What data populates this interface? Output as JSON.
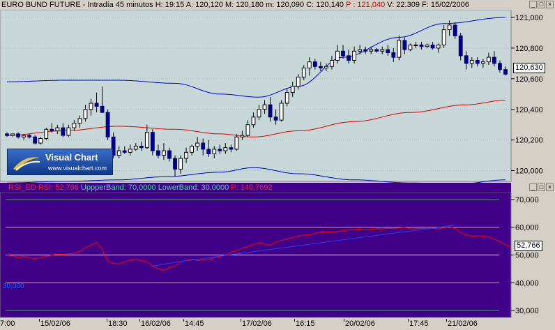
{
  "main_pane": {
    "title": {
      "instrument": "EURO BUND FUTURE - Intradía 45 minutos",
      "h": "H: 19:15",
      "a": "A: 120,120",
      "m": "M: 120,180",
      "m2": "m: 120,090",
      "c": "C: 120,140",
      "p": "P : 121,040",
      "v": "V: 22.309",
      "f": "F: 15/02/2006"
    },
    "price_tag": "120,630",
    "y_ticks": [
      "121,000",
      "120,800",
      "120,600",
      "120,400",
      "120,200",
      "120,000"
    ],
    "logo": {
      "line1": "Visual Chart",
      "line2": "www.visualchart.com"
    }
  },
  "rsi_pane": {
    "title": {
      "name": "RSI_ED",
      "rsi": "RSI: 52,766",
      "upper": "UppperBand: 70,0000",
      "lower": "LowerBand: 30,0000",
      "p": "P: 140,7692"
    },
    "value_tag": "52,766",
    "left_tag": "30,000",
    "y_ticks": [
      "70,000",
      "60,000",
      "50,000",
      "40,000",
      "30,000"
    ]
  },
  "x_axis_labels": [
    "7:00",
    "15/02/06",
    "18:30",
    "16/02/06",
    "14:45",
    "17/02/06",
    "16:15",
    "20/02/06",
    "17:45",
    "21/02/06"
  ],
  "colors": {
    "chart_bg": "#c8d8d8",
    "rsi_bg": "#400088",
    "boll": "#0000cc",
    "ma": "#dd0000",
    "rsi_line": "#ff0000"
  },
  "chart_data": [
    {
      "type": "candlestick",
      "title": "EURO BUND FUTURE - Intradía 45 minutos",
      "ylim": [
        119.93,
        121.05
      ],
      "x_labels": [
        "7:00",
        "15/02/06",
        "18:30",
        "16/02/06",
        "14:45",
        "17/02/06",
        "16:15",
        "20/02/06",
        "17:45",
        "21/02/06"
      ],
      "candles": [
        [
          120.24,
          120.25,
          120.22,
          120.23
        ],
        [
          120.23,
          120.24,
          120.22,
          120.24
        ],
        [
          120.24,
          120.25,
          120.21,
          120.22
        ],
        [
          120.22,
          120.24,
          120.2,
          120.23
        ],
        [
          120.23,
          120.24,
          120.21,
          120.22
        ],
        [
          120.22,
          120.23,
          120.17,
          120.18
        ],
        [
          120.18,
          120.22,
          120.17,
          120.21
        ],
        [
          120.21,
          120.28,
          120.2,
          120.27
        ],
        [
          120.27,
          120.31,
          120.25,
          120.26
        ],
        [
          120.26,
          120.3,
          120.24,
          120.28
        ],
        [
          120.28,
          120.31,
          120.22,
          120.23
        ],
        [
          120.23,
          120.3,
          120.22,
          120.28
        ],
        [
          120.28,
          120.33,
          120.26,
          120.31
        ],
        [
          120.31,
          120.36,
          120.28,
          120.34
        ],
        [
          120.34,
          120.43,
          120.32,
          120.4
        ],
        [
          120.4,
          120.47,
          120.36,
          120.44
        ],
        [
          120.44,
          120.51,
          120.38,
          120.42
        ],
        [
          120.42,
          120.55,
          120.4,
          120.38
        ],
        [
          120.38,
          120.4,
          120.2,
          120.22
        ],
        [
          120.22,
          120.25,
          120.08,
          120.1
        ],
        [
          120.1,
          120.16,
          120.08,
          120.13
        ],
        [
          120.13,
          120.16,
          120.11,
          120.12
        ],
        [
          120.12,
          120.17,
          120.1,
          120.14
        ],
        [
          120.14,
          120.18,
          120.13,
          120.16
        ],
        [
          120.16,
          120.19,
          120.13,
          120.15
        ],
        [
          120.15,
          120.3,
          120.14,
          120.25
        ],
        [
          120.25,
          120.27,
          120.1,
          120.13
        ],
        [
          120.13,
          120.17,
          120.08,
          120.1
        ],
        [
          120.1,
          120.18,
          120.07,
          120.13
        ],
        [
          120.13,
          120.15,
          120.06,
          120.08
        ],
        [
          120.08,
          120.1,
          119.96,
          120.01
        ],
        [
          120.01,
          120.1,
          119.98,
          120.08
        ],
        [
          120.08,
          120.15,
          120.05,
          120.12
        ],
        [
          120.12,
          120.17,
          120.1,
          120.16
        ],
        [
          120.16,
          120.22,
          120.13,
          120.18
        ],
        [
          120.18,
          120.21,
          120.1,
          120.14
        ],
        [
          120.14,
          120.2,
          120.09,
          120.11
        ],
        [
          120.11,
          120.16,
          120.08,
          120.14
        ],
        [
          120.14,
          120.17,
          120.11,
          120.13
        ],
        [
          120.13,
          120.18,
          120.11,
          120.15
        ],
        [
          120.15,
          120.17,
          120.12,
          120.14
        ],
        [
          120.14,
          120.24,
          120.13,
          120.22
        ],
        [
          120.22,
          120.26,
          120.2,
          120.23
        ],
        [
          120.23,
          120.33,
          120.22,
          120.3
        ],
        [
          120.3,
          120.38,
          120.28,
          120.35
        ],
        [
          120.35,
          120.43,
          120.33,
          120.4
        ],
        [
          120.4,
          120.46,
          120.37,
          120.43
        ],
        [
          120.43,
          120.48,
          120.32,
          120.35
        ],
        [
          120.35,
          120.4,
          120.3,
          120.33
        ],
        [
          120.33,
          120.46,
          120.32,
          120.44
        ],
        [
          120.44,
          120.54,
          120.42,
          120.51
        ],
        [
          120.51,
          120.58,
          120.48,
          120.55
        ],
        [
          120.55,
          120.63,
          120.53,
          120.61
        ],
        [
          120.61,
          120.69,
          120.59,
          120.67
        ],
        [
          120.67,
          120.74,
          120.62,
          120.71
        ],
        [
          120.71,
          120.73,
          120.66,
          120.68
        ],
        [
          120.68,
          120.71,
          120.65,
          120.67
        ],
        [
          120.67,
          120.7,
          120.65,
          120.68
        ],
        [
          120.68,
          120.75,
          120.66,
          120.72
        ],
        [
          120.72,
          120.82,
          120.7,
          120.78
        ],
        [
          120.78,
          120.82,
          120.73,
          120.75
        ],
        [
          120.75,
          120.79,
          120.7,
          120.72
        ],
        [
          120.72,
          120.81,
          120.7,
          120.78
        ],
        [
          120.78,
          120.82,
          120.76,
          120.79
        ],
        [
          120.79,
          120.81,
          120.76,
          120.78
        ],
        [
          120.78,
          120.81,
          120.76,
          120.79
        ],
        [
          120.79,
          120.8,
          120.77,
          120.78
        ],
        [
          120.78,
          120.81,
          120.76,
          120.79
        ],
        [
          120.79,
          120.82,
          120.75,
          120.77
        ],
        [
          120.77,
          120.8,
          120.71,
          120.74
        ],
        [
          120.74,
          120.88,
          120.72,
          120.85
        ],
        [
          120.85,
          120.87,
          120.76,
          120.79
        ],
        [
          120.79,
          120.83,
          120.78,
          120.82
        ],
        [
          120.82,
          120.84,
          120.8,
          120.82
        ],
        [
          120.82,
          120.84,
          120.79,
          120.81
        ],
        [
          120.81,
          120.83,
          120.8,
          120.82
        ],
        [
          120.82,
          120.84,
          120.79,
          120.8
        ],
        [
          120.8,
          120.83,
          120.77,
          120.82
        ],
        [
          120.82,
          120.95,
          120.8,
          120.92
        ],
        [
          120.92,
          120.98,
          120.88,
          120.95
        ],
        [
          120.95,
          120.97,
          120.86,
          120.88
        ],
        [
          120.88,
          120.9,
          120.72,
          120.75
        ],
        [
          120.75,
          120.78,
          120.66,
          120.7
        ],
        [
          120.7,
          120.74,
          120.67,
          120.72
        ],
        [
          120.72,
          120.74,
          120.68,
          120.7
        ],
        [
          120.7,
          120.73,
          120.67,
          120.71
        ],
        [
          120.71,
          120.77,
          120.69,
          120.74
        ],
        [
          120.74,
          120.78,
          120.68,
          120.7
        ],
        [
          120.7,
          120.72,
          120.64,
          120.66
        ],
        [
          120.66,
          120.68,
          120.62,
          120.63
        ]
      ],
      "bollinger_upper": [
        [
          0,
          120.58
        ],
        [
          10,
          120.59
        ],
        [
          20,
          120.59
        ],
        [
          30,
          120.57
        ],
        [
          38,
          120.5
        ],
        [
          45,
          120.48
        ],
        [
          52,
          120.55
        ],
        [
          60,
          120.74
        ],
        [
          70,
          120.87
        ],
        [
          78,
          120.96
        ],
        [
          89,
          121.0
        ]
      ],
      "bollinger_lower": [
        [
          0,
          119.92
        ],
        [
          10,
          119.93
        ],
        [
          20,
          119.94
        ],
        [
          28,
          119.96
        ],
        [
          38,
          119.99
        ],
        [
          44,
          120.02
        ],
        [
          52,
          119.98
        ],
        [
          62,
          119.94
        ],
        [
          72,
          119.92
        ],
        [
          80,
          119.91
        ],
        [
          89,
          119.94
        ]
      ],
      "moving_average": [
        [
          0,
          120.23
        ],
        [
          10,
          120.26
        ],
        [
          20,
          120.29
        ],
        [
          30,
          120.27
        ],
        [
          38,
          120.24
        ],
        [
          44,
          120.22
        ],
        [
          52,
          120.26
        ],
        [
          62,
          120.32
        ],
        [
          72,
          120.38
        ],
        [
          82,
          120.43
        ],
        [
          89,
          120.46
        ]
      ]
    },
    {
      "type": "line",
      "title": "RSI_ED",
      "ylim": [
        27.5,
        72.5
      ],
      "levels": [
        70,
        30
      ],
      "series": [
        {
          "name": "RSI",
          "values": [
            50.0,
            49.7,
            49.2,
            49.5,
            49.0,
            48.7,
            49.2,
            49.5,
            50.0,
            50.3,
            50.2,
            50.4,
            50.6,
            51.2,
            52.8,
            53.5,
            54.6,
            52.0,
            47.8,
            47.0,
            46.8,
            47.5,
            48.2,
            48.5,
            48.0,
            47.5,
            46.0,
            45.2,
            44.5,
            45.5,
            46.0,
            47.5,
            48.0,
            48.5,
            48.0,
            48.3,
            48.5,
            49.0,
            49.4,
            50.0,
            51.0,
            51.5,
            52.5,
            53.0,
            53.8,
            54.4,
            54.0,
            53.5,
            54.6,
            55.2,
            55.8,
            56.3,
            56.8,
            57.2,
            57.3,
            57.8,
            58.3,
            58.4,
            58.2,
            58.5,
            58.8,
            59.0,
            59.2,
            59.4,
            59.0,
            59.3,
            59.5,
            59.4,
            59.6,
            59.5,
            59.8,
            60.0,
            59.4,
            59.5,
            59.6,
            59.5,
            59.6,
            59.4,
            59.8,
            60.2,
            59.7,
            58.0,
            57.3,
            56.8,
            57.0,
            56.8,
            56.5,
            55.8,
            54.8,
            53.8,
            52.8
          ]
        },
        {
          "name": "",
          "values": [
            46.0,
            47.5,
            48.7,
            50.0,
            51.2,
            52.4,
            53.6,
            54.8,
            56.0,
            57.2,
            58.4,
            59.5,
            60.8
          ]
        }
      ]
    }
  ]
}
